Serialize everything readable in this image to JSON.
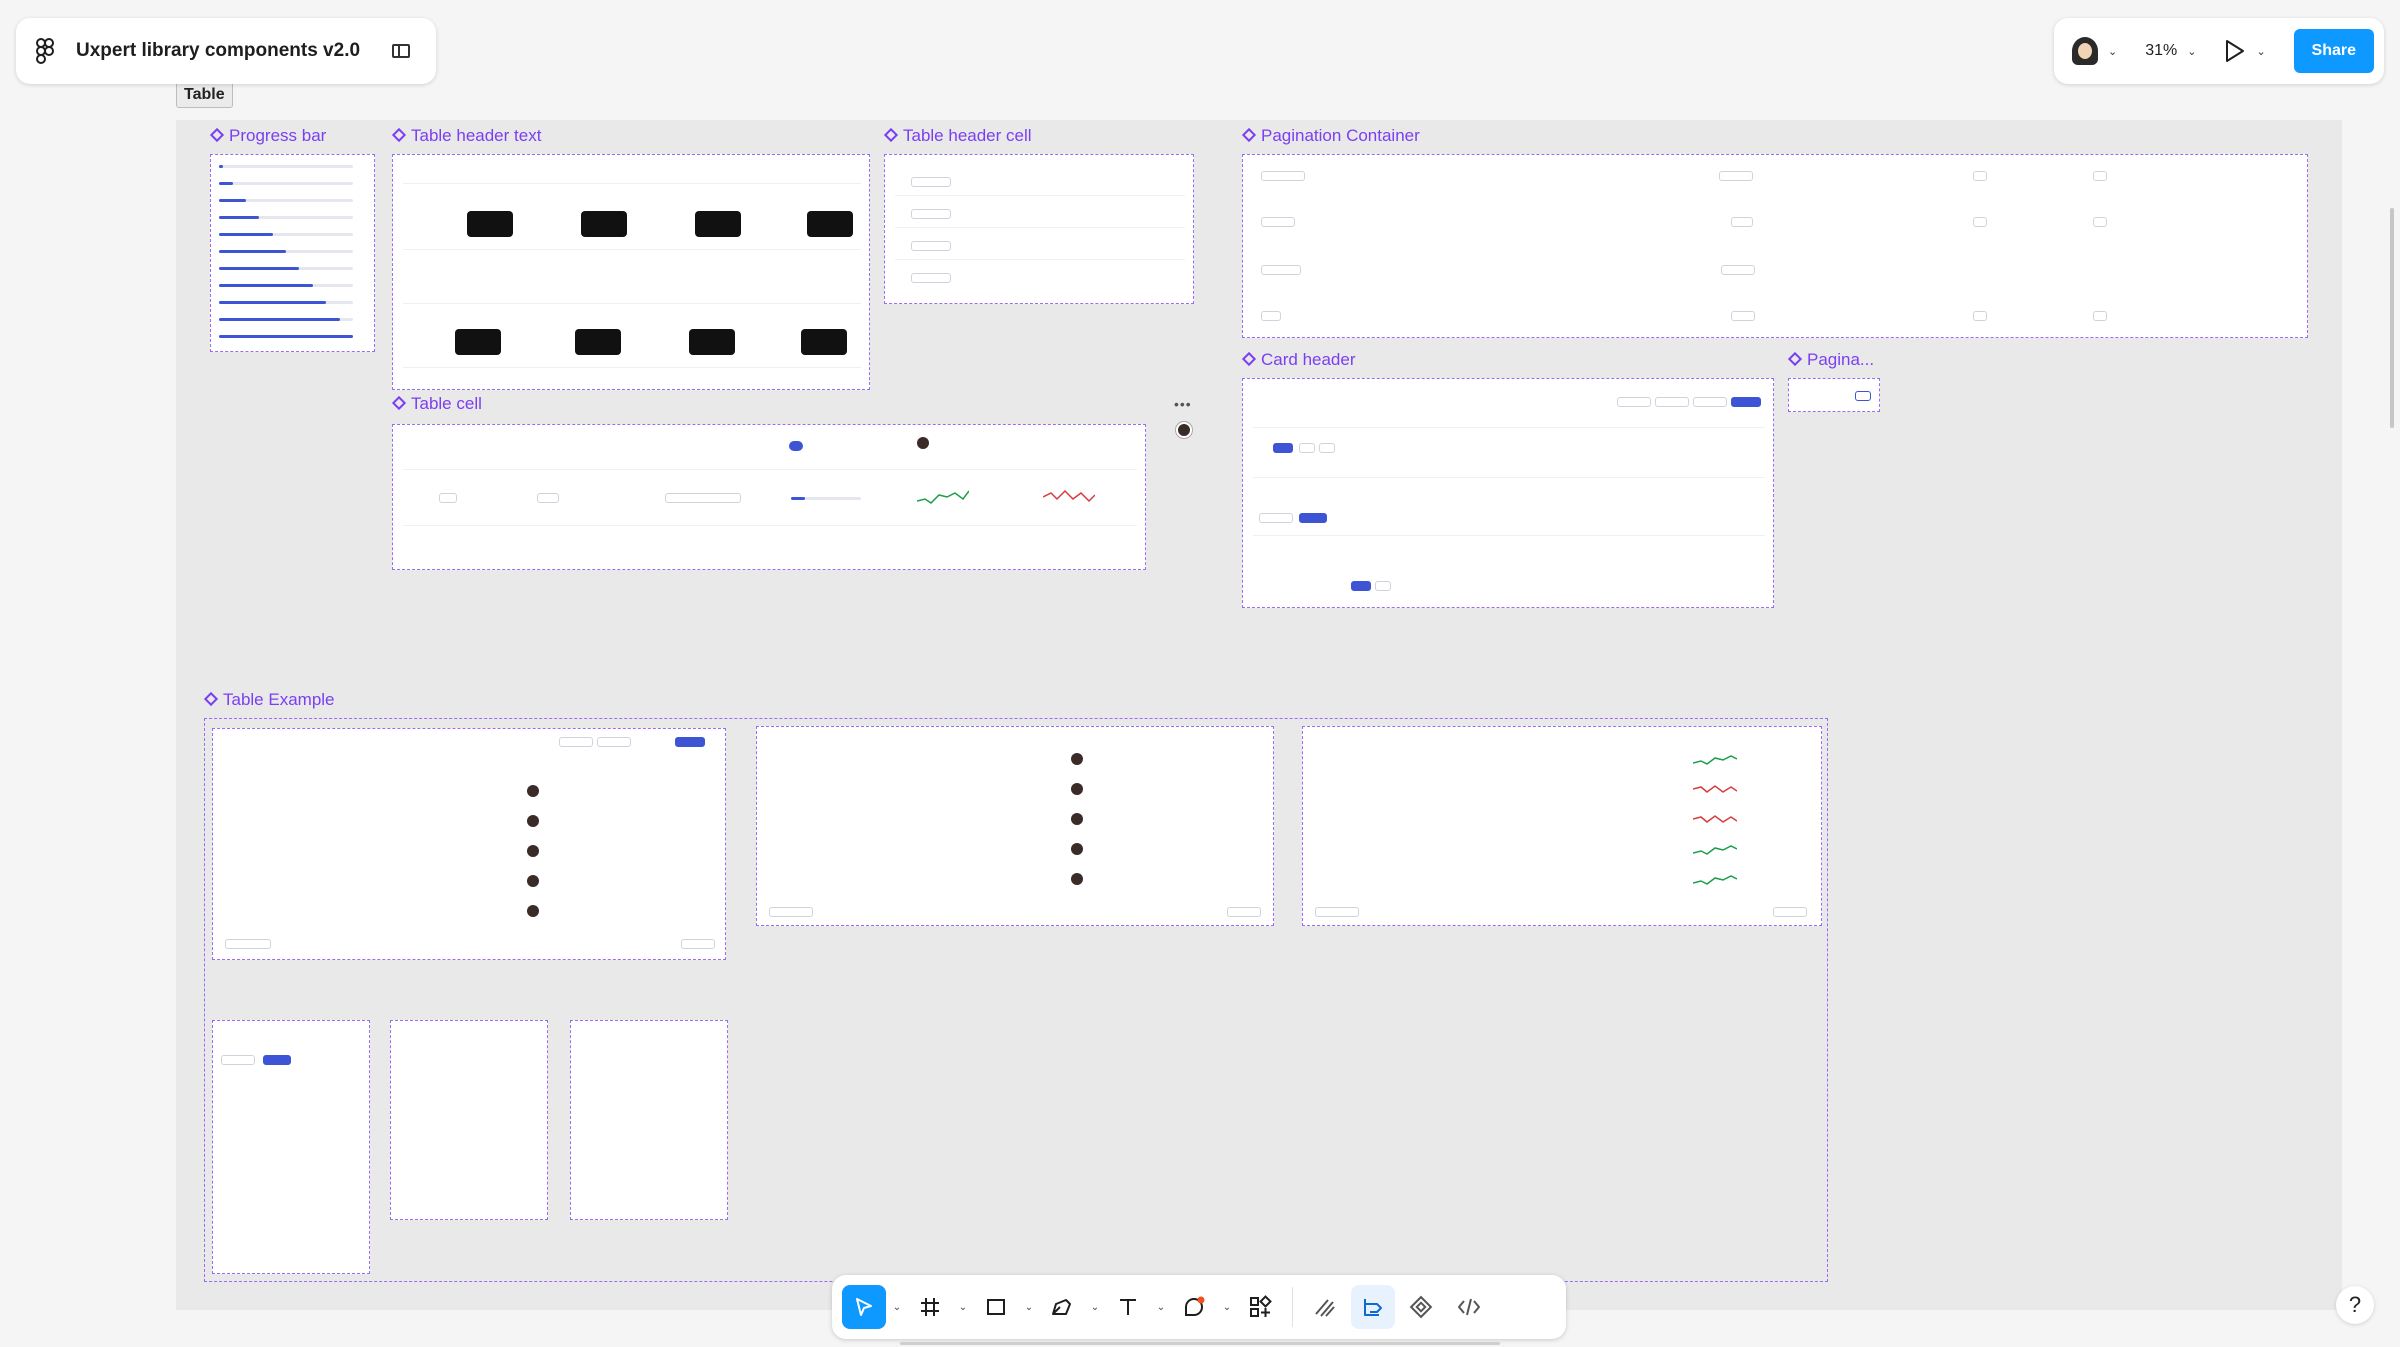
{
  "app": {
    "file_title": "Uxpert library components v2.0",
    "zoom": "31%",
    "share_label": "Share",
    "help_label": "?"
  },
  "canvas": {
    "section_tag": "Table",
    "frames": {
      "progress_bar": "Progress bar",
      "table_header_text": "Table header text",
      "table_header_cell": "Table header cell",
      "pagination_container": "Pagination Container",
      "table_cell": "Table cell",
      "card_header": "Card header",
      "pagination": "Pagina...",
      "table_example": "Table Example"
    }
  },
  "toolbar": {
    "tools": [
      "move-tool",
      "frame-tool",
      "rectangle-tool",
      "pen-tool",
      "text-tool",
      "comment-tool",
      "resources-tool",
      "draw-mode",
      "design-mode",
      "prototype-mode",
      "dev-mode"
    ]
  }
}
